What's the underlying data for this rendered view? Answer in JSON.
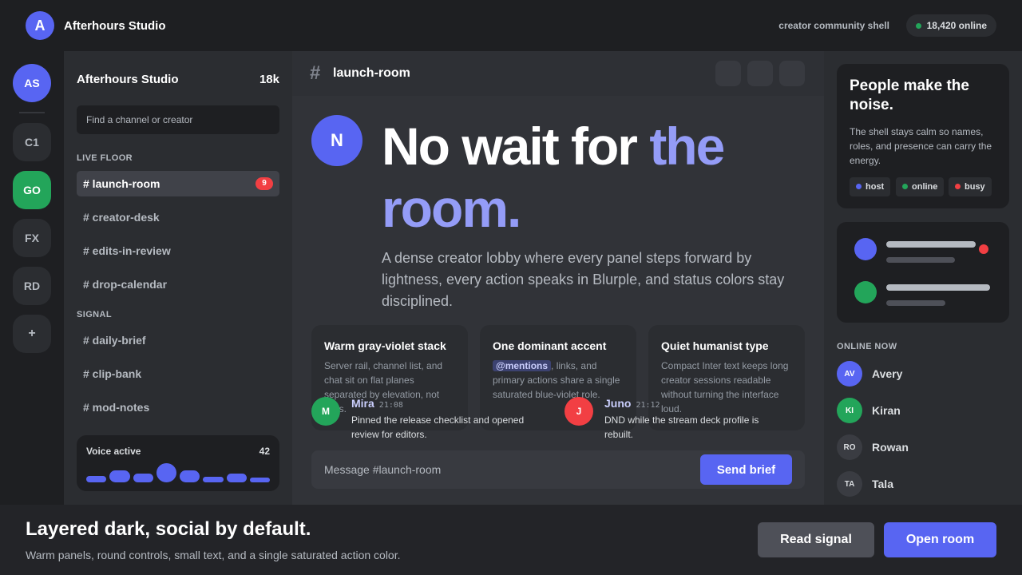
{
  "topbar": {
    "logo_letter": "A",
    "brand": "Afterhours Studio",
    "shell_label": "creator community shell",
    "online_count": "18,420 online"
  },
  "rail": {
    "servers": [
      "AS",
      "C1",
      "GO",
      "FX",
      "RD",
      "+"
    ]
  },
  "channels": {
    "server_name": "Afterhours Studio",
    "member_count": "18k",
    "search_placeholder": "Find a channel or creator",
    "sections": [
      {
        "label": "LIVE FLOOR",
        "items": [
          "# launch-room",
          "# creator-desk",
          "# edits-in-review",
          "# drop-calendar"
        ]
      },
      {
        "label": "SIGNAL",
        "items": [
          "# daily-brief",
          "# clip-bank",
          "# mod-notes"
        ]
      }
    ],
    "unread_badge": "9",
    "voice": {
      "label": "Voice active",
      "count": "42"
    }
  },
  "main": {
    "room": "launch-room",
    "hero_avatar": "N",
    "hero_plain": "No wait for ",
    "hero_accent": "the room.",
    "lede": "A dense creator lobby where every panel steps forward by lightness, every action speaks in Blurple, and status colors stay disciplined.",
    "cards": [
      {
        "title": "Warm gray-violet stack",
        "body": "Server rail, channel list, and chat sit on flat planes separated by elevation, not lines."
      },
      {
        "title": "One dominant accent",
        "mention": "@mentions",
        "body": ", links, and primary actions share a single saturated blue-violet role."
      },
      {
        "title": "Quiet humanist type",
        "body": "Compact Inter text keeps long creator sessions readable without turning the interface loud."
      }
    ],
    "messages": [
      {
        "initial": "M",
        "name": "Mira",
        "time": "21:08",
        "text": "Pinned the release checklist and opened review for editors."
      },
      {
        "initial": "J",
        "name": "Juno",
        "time": "21:12",
        "text": "DND while the stream deck profile is rebuilt."
      }
    ],
    "composer_placeholder": "Message #launch-room",
    "send_label": "Send brief"
  },
  "right": {
    "promo_title": "People make the noise.",
    "promo_body": "The shell stays calm so names, roles, and presence can carry the energy.",
    "tags": [
      "host",
      "online",
      "busy"
    ],
    "online_label": "ONLINE NOW",
    "members": [
      {
        "initials": "AV",
        "name": "Avery"
      },
      {
        "initials": "KI",
        "name": "Kiran"
      },
      {
        "initials": "RO",
        "name": "Rowan"
      },
      {
        "initials": "TA",
        "name": "Tala"
      }
    ]
  },
  "footer": {
    "title": "Layered dark, social by default.",
    "subtitle": "Warm panels, round controls, small text, and a single saturated action color.",
    "secondary_label": "Read signal",
    "primary_label": "Open room"
  },
  "colors": {
    "blurple": "#5865f2",
    "accent_text": "#949cf7",
    "online": "#23a55a",
    "busy": "#f23f43"
  }
}
